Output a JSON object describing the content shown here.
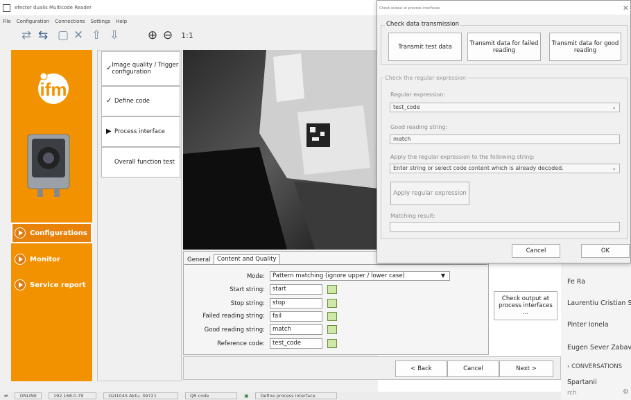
{
  "window": {
    "title": "efector dualis Multicode Reader"
  },
  "menu": [
    "File",
    "Configuration",
    "Connections",
    "Settings",
    "Help"
  ],
  "toolbar": {
    "zoom_label": "1:1"
  },
  "steps": [
    {
      "mark": "✓",
      "label": "Image quality / Trigger configuration"
    },
    {
      "mark": "✓",
      "label": "Define code"
    },
    {
      "mark": "▶",
      "label": "Process interface"
    },
    {
      "mark": "",
      "label": "Overall function test"
    }
  ],
  "nav": {
    "configurations": "Configurations",
    "monitor": "Monitor",
    "service_report": "Service report"
  },
  "tabs": {
    "general": "General",
    "content_quality": "Content and Quality"
  },
  "form": {
    "mode_label": "Mode:",
    "mode_value": "Pattern matching (ignore upper / lower case)",
    "start_label": "Start string:",
    "start_value": "start",
    "stop_label": "Stop string:",
    "stop_value": "stop",
    "failed_label": "Failed reading string:",
    "failed_value": "fail",
    "good_label": "Good reading string:",
    "good_value": "match",
    "ref_label": "Reference code:",
    "ref_value": "test_code"
  },
  "check_output_btn": "Check output at process interfaces ...",
  "wizard": {
    "back": "< Back",
    "cancel": "Cancel",
    "next": "Next >"
  },
  "status": {
    "online": "ONLINE",
    "ip": "192.168.0.79",
    "device": "O2I104S Aktu. 39721",
    "code": "QR code",
    "activity": "Define process interface"
  },
  "dialog": {
    "title": "Check output at process interfaces",
    "transmission_group": "Check data transmission",
    "transmit_test": "Transmit test data",
    "transmit_failed": "Transmit data for failed reading",
    "transmit_good": "Transmit data for good reading",
    "regex_group": "Check the regular expression",
    "regex_label": "Regular expression:",
    "regex_value": "test_code",
    "good_string_label": "Good reading string:",
    "good_string_value": "match",
    "apply_to_label": "Apply the regular expression to the following string:",
    "apply_to_placeholder": "Enter string or select code content which is already decoded.",
    "apply_btn": "Apply regular expression",
    "matching_label": "Matching result:",
    "cancel": "Cancel",
    "ok": "OK"
  },
  "chat_panel": {
    "contacts": [
      "Fe Ra",
      "Laurentiu Cristian S...",
      "Pinter Ionela",
      "Eugen Sever Zabava"
    ],
    "conversations_header": "CONVERSATIONS",
    "conversation": "Spartanii",
    "search_placeholder": "rch"
  },
  "colors": {
    "orange": "#f39200",
    "accent": "#e07d10"
  }
}
